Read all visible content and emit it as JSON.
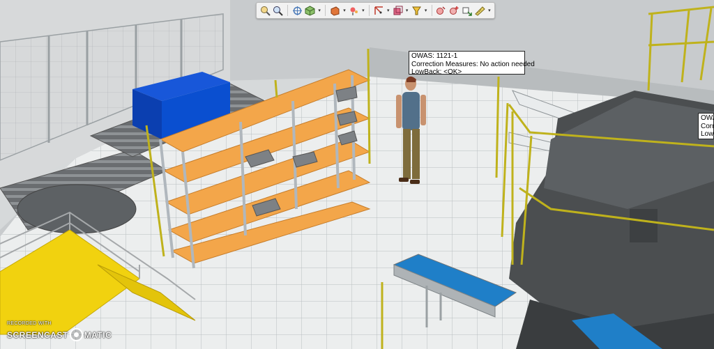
{
  "toolbar": {
    "buttons": [
      {
        "name": "zoom-fit-icon",
        "dropdown": false
      },
      {
        "name": "zoom-icon",
        "dropdown": false
      },
      {
        "name": "pan-icon",
        "dropdown": false
      },
      {
        "name": "view-cube-icon",
        "dropdown": true
      },
      {
        "name": "render-mode-icon",
        "dropdown": true
      },
      {
        "name": "light-icon",
        "dropdown": true
      },
      {
        "name": "frame-icon",
        "dropdown": true
      },
      {
        "name": "box-select-icon",
        "dropdown": true
      },
      {
        "name": "marker-icon",
        "dropdown": true
      },
      {
        "name": "collision-icon",
        "dropdown": false
      },
      {
        "name": "place-icon",
        "dropdown": false
      },
      {
        "name": "transform-icon",
        "dropdown": false
      },
      {
        "name": "measure-icon",
        "dropdown": true
      }
    ]
  },
  "tooltips": [
    {
      "owas": "OWAS:   1121-1",
      "correction": "Correction Measures: No action needed",
      "lowback": "LowBack:  <OK>"
    },
    {
      "owas": "OWAS",
      "correction": "Correc",
      "lowback": "LowB"
    }
  ],
  "watermark": {
    "small": "RECORDED WITH",
    "left": "SCREENCAST",
    "right": "MATIC"
  },
  "colors": {
    "floor": "#e9ebeb",
    "wall": "#c9cccd",
    "shelf": "#f3a64a",
    "frame": "#b0b7bd",
    "box": "#0a4fd0",
    "rail": "#bfb21c",
    "platform": "#f1d20f",
    "machine": "#4b4e50",
    "conveyor_belt": "#1f7fc8"
  }
}
